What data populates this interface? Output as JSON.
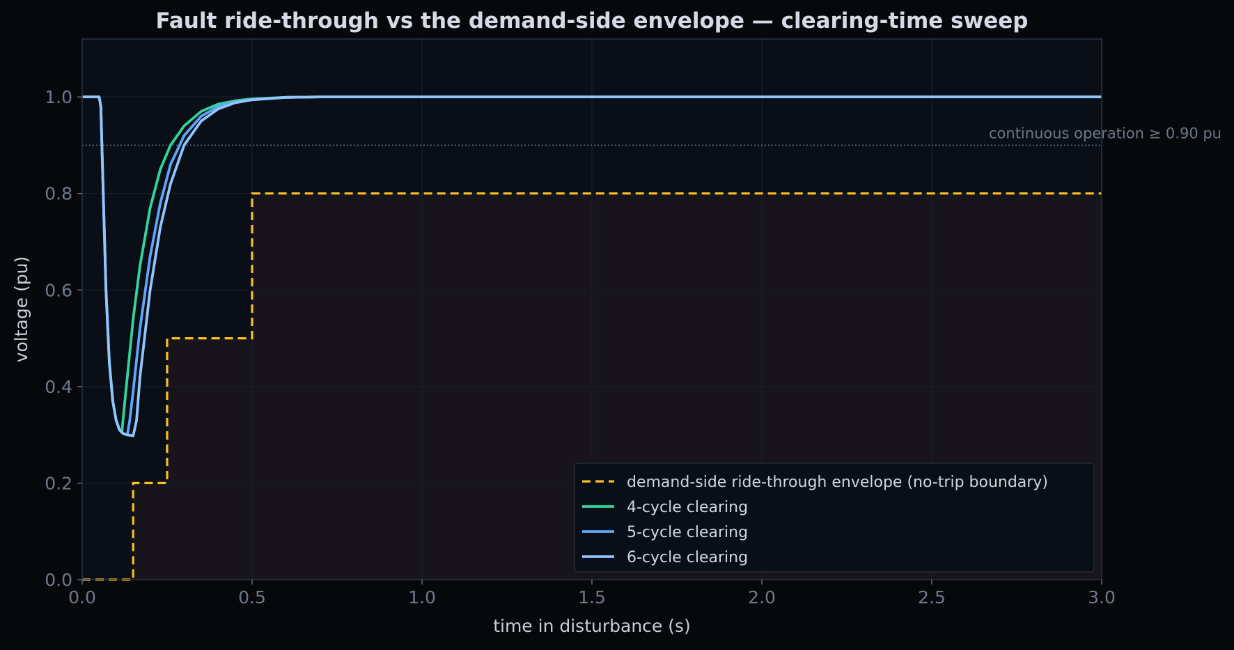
{
  "chart_data": {
    "type": "line",
    "title": "Fault ride-through vs the demand-side envelope — clearing-time sweep",
    "xlabel": "time in disturbance (s)",
    "ylabel": "voltage (pu)",
    "xlim": [
      0,
      3.0
    ],
    "ylim": [
      0,
      1.12
    ],
    "xticks": [
      0.0,
      0.5,
      1.0,
      1.5,
      2.0,
      2.5,
      3.0
    ],
    "yticks": [
      0.0,
      0.2,
      0.4,
      0.6,
      0.8,
      1.0
    ],
    "xtick_labels": [
      "0.0",
      "0.5",
      "1.0",
      "1.5",
      "2.0",
      "2.5",
      "3.0"
    ],
    "ytick_labels": [
      "0.0",
      "0.2",
      "0.4",
      "0.6",
      "0.8",
      "1.0"
    ],
    "grid": true,
    "legend_position": "bottom-right",
    "annotation": {
      "text": "continuous operation ≥ 0.90 pu",
      "y": 0.9,
      "color": "#7c8797"
    },
    "envelope": {
      "name": "demand-side ride-through envelope (no-trip boundary)",
      "color": "#fbbf24",
      "style": "dashed",
      "x": [
        0.0,
        0.15,
        0.15,
        0.25,
        0.25,
        0.5,
        0.5,
        3.0
      ],
      "y": [
        0.0,
        0.0,
        0.2,
        0.2,
        0.5,
        0.5,
        0.8,
        0.8
      ]
    },
    "series": [
      {
        "name": "4-cycle clearing",
        "color": "#34d399",
        "x": [
          0.0,
          0.05,
          0.055,
          0.06,
          0.07,
          0.08,
          0.09,
          0.1,
          0.11,
          0.117,
          0.12,
          0.13,
          0.15,
          0.17,
          0.2,
          0.23,
          0.26,
          0.3,
          0.35,
          0.4,
          0.45,
          0.5,
          0.6,
          0.7,
          0.8,
          1.0,
          1.5,
          2.0,
          2.5,
          3.0
        ],
        "y": [
          1.0,
          1.0,
          0.98,
          0.85,
          0.6,
          0.45,
          0.37,
          0.33,
          0.31,
          0.305,
          0.33,
          0.4,
          0.54,
          0.65,
          0.77,
          0.85,
          0.9,
          0.94,
          0.97,
          0.985,
          0.992,
          0.996,
          0.999,
          1.0,
          1.0,
          1.0,
          1.0,
          1.0,
          1.0,
          1.0
        ]
      },
      {
        "name": "5-cycle clearing",
        "color": "#60a5fa",
        "x": [
          0.0,
          0.05,
          0.055,
          0.06,
          0.07,
          0.08,
          0.09,
          0.1,
          0.11,
          0.12,
          0.133,
          0.14,
          0.15,
          0.17,
          0.2,
          0.23,
          0.26,
          0.3,
          0.35,
          0.4,
          0.45,
          0.5,
          0.6,
          0.7,
          0.8,
          1.0,
          1.5,
          2.0,
          2.5,
          3.0
        ],
        "y": [
          1.0,
          1.0,
          0.98,
          0.85,
          0.6,
          0.45,
          0.37,
          0.33,
          0.31,
          0.303,
          0.3,
          0.33,
          0.39,
          0.52,
          0.67,
          0.78,
          0.86,
          0.92,
          0.96,
          0.98,
          0.99,
          0.995,
          0.999,
          1.0,
          1.0,
          1.0,
          1.0,
          1.0,
          1.0,
          1.0
        ]
      },
      {
        "name": "6-cycle clearing",
        "color": "#93c5fd",
        "x": [
          0.0,
          0.05,
          0.055,
          0.06,
          0.07,
          0.08,
          0.09,
          0.1,
          0.11,
          0.12,
          0.13,
          0.15,
          0.16,
          0.17,
          0.2,
          0.23,
          0.26,
          0.3,
          0.35,
          0.4,
          0.45,
          0.5,
          0.6,
          0.7,
          0.8,
          1.0,
          1.5,
          2.0,
          2.5,
          3.0
        ],
        "y": [
          1.0,
          1.0,
          0.98,
          0.85,
          0.6,
          0.45,
          0.37,
          0.33,
          0.31,
          0.303,
          0.3,
          0.298,
          0.33,
          0.42,
          0.6,
          0.73,
          0.82,
          0.9,
          0.95,
          0.975,
          0.988,
          0.994,
          0.999,
          1.0,
          1.0,
          1.0,
          1.0,
          1.0,
          1.0,
          1.0
        ]
      }
    ],
    "colors": {
      "page_background": "#06080b",
      "plot_background": "#0a0f17",
      "trip_region_fill": "#17141b",
      "grid": "#1a212c",
      "spine": "#2a3442",
      "legend_background": "#0a0f17",
      "legend_border": "#2a3442"
    }
  }
}
